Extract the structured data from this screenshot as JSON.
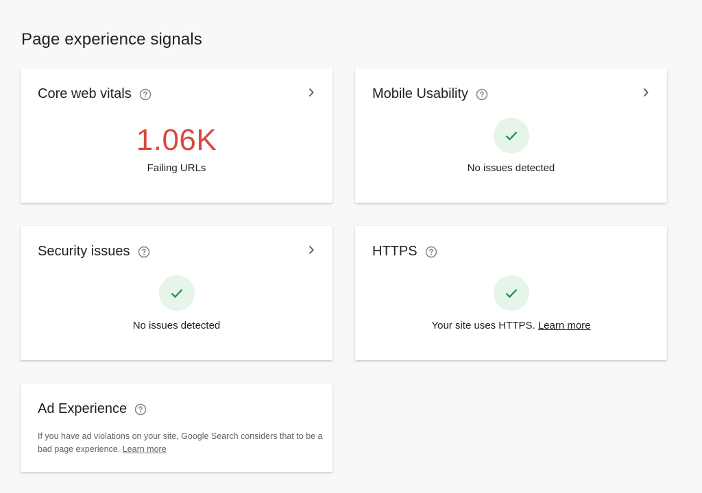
{
  "page": {
    "title": "Page experience signals"
  },
  "cards": {
    "core_web_vitals": {
      "title": "Core web vitals",
      "metric": "1.06K",
      "metric_label": "Failing URLs",
      "metric_color": "#d9473f"
    },
    "mobile_usability": {
      "title": "Mobile Usability",
      "status": "No issues detected"
    },
    "security_issues": {
      "title": "Security issues",
      "status": "No issues detected"
    },
    "https": {
      "title": "HTTPS",
      "status": "Your site uses HTTPS.",
      "link": "Learn more"
    },
    "ad_experience": {
      "title": "Ad Experience",
      "description": "If you have ad violations on your site, Google Search considers that to be a bad page experience.",
      "link": "Learn more"
    }
  },
  "icons": {
    "help": "help-circle-icon",
    "chevron": "chevron-right-icon",
    "check": "check-icon"
  },
  "colors": {
    "error": "#d9473f",
    "success": "#1e8e3e",
    "success_bg": "#e6f4ea"
  }
}
